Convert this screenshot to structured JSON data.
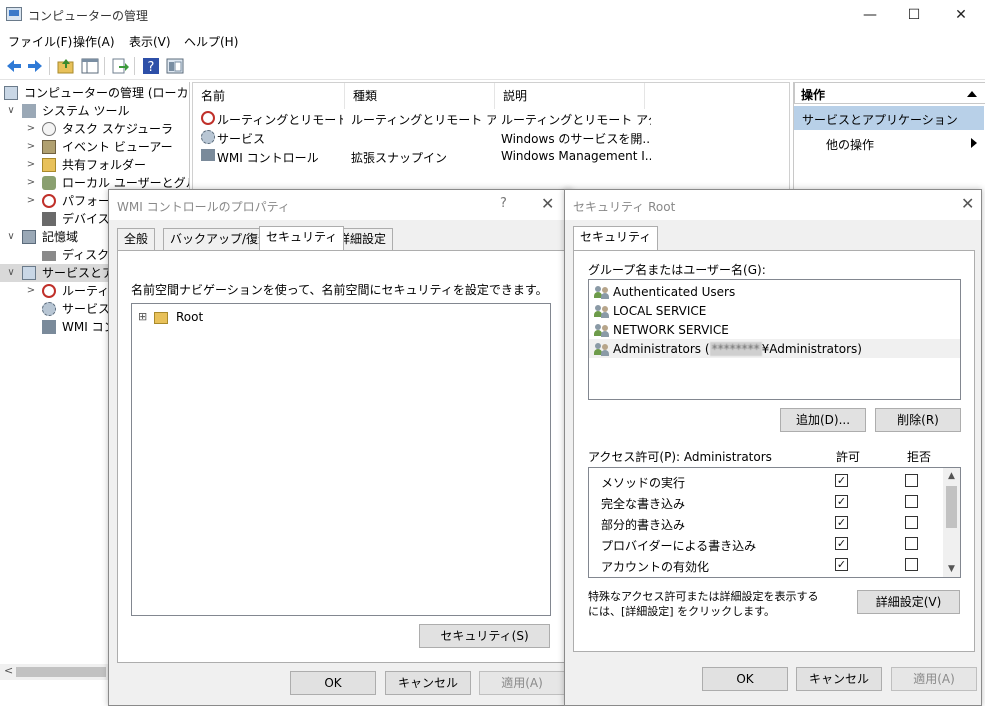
{
  "window": {
    "title": "コンピューターの管理",
    "minimize": "—",
    "maximize": "☐",
    "close": "✕"
  },
  "menu": [
    "ファイル(F)",
    "操作(A)",
    "表示(V)",
    "ヘルプ(H)"
  ],
  "toolbar": {
    "icons": [
      "back-icon",
      "forward-icon",
      "up-folder-icon",
      "show-hide-tree-icon",
      "export-icon",
      "help-icon",
      "console-icon"
    ]
  },
  "tree": {
    "items": [
      {
        "label": "コンピューターの管理 (ローカル)",
        "icon": "computer-management-icon"
      },
      {
        "label": "システム ツール",
        "icon": "tools-icon"
      },
      {
        "label": "タスク スケジューラ",
        "icon": "clock-icon"
      },
      {
        "label": "イベント ビューアー",
        "icon": "event-viewer-icon"
      },
      {
        "label": "共有フォルダー",
        "icon": "shared-folder-icon"
      },
      {
        "label": "ローカル ユーザーとグループ",
        "icon": "users-icon"
      },
      {
        "label": "パフォーマ",
        "icon": "performance-icon"
      },
      {
        "label": "デバイス マ",
        "icon": "device-manager-icon"
      },
      {
        "label": "記憶域",
        "icon": "storage-icon"
      },
      {
        "label": "ディスクの",
        "icon": "disk-icon"
      },
      {
        "label": "サービスとアプ",
        "icon": "services-apps-icon"
      },
      {
        "label": "ルーティン",
        "icon": "routing-icon"
      },
      {
        "label": "サービス",
        "icon": "gear-icon"
      },
      {
        "label": "WMI コン",
        "icon": "wmi-icon"
      }
    ]
  },
  "list": {
    "headers": [
      "名前",
      "種類",
      "説明"
    ],
    "rows": [
      {
        "name": "ルーティングとリモート アク...",
        "type": "ルーティングとリモート アクセス",
        "desc": "ルーティングとリモート アクセス",
        "icon": "routing-icon"
      },
      {
        "name": "サービス",
        "type": "",
        "desc": "Windows のサービスを開...",
        "icon": "gear-icon"
      },
      {
        "name": "WMI コントロール",
        "type": "拡張スナップイン",
        "desc": "Windows Management I...",
        "icon": "wmi-icon"
      }
    ]
  },
  "actions": {
    "title": "操作",
    "section": "サービスとアプリケーション",
    "item": "他の操作"
  },
  "wmi_dialog": {
    "title": "WMI コントロールのプロパティ",
    "help": "?",
    "close": "✕",
    "tabs": [
      "全般",
      "バックアップ/復元",
      "セキュリティ",
      "詳細設定"
    ],
    "description": "名前空間ナビゲーションを使って、名前空間にセキュリティを設定できます。",
    "tree_expand": "⊞",
    "tree_root": "Root",
    "security_button": "セキュリティ(S)",
    "ok": "OK",
    "cancel": "キャンセル",
    "apply": "適用(A)"
  },
  "security_dialog": {
    "title": "セキュリティ Root",
    "close": "✕",
    "tab": "セキュリティ",
    "group_label": "グループ名またはユーザー名(G):",
    "users": [
      {
        "name": "Authenticated Users"
      },
      {
        "name": "LOCAL SERVICE"
      },
      {
        "name": "NETWORK SERVICE"
      },
      {
        "name_prefix": "Administrators (",
        "masked": "********",
        "name_suffix": "¥Administrators)"
      }
    ],
    "add_button": "追加(D)...",
    "remove_button": "削除(R)",
    "perm_label": "アクセス許可(P): Administrators",
    "allow_header": "許可",
    "deny_header": "拒否",
    "permissions": [
      {
        "name": "メソッドの実行",
        "allow": true,
        "deny": false
      },
      {
        "name": "完全な書き込み",
        "allow": true,
        "deny": false
      },
      {
        "name": "部分的書き込み",
        "allow": true,
        "deny": false
      },
      {
        "name": "プロバイダーによる書き込み",
        "allow": true,
        "deny": false
      },
      {
        "name": "アカウントの有効化",
        "allow": true,
        "deny": false
      }
    ],
    "advanced_text_1": "特殊なアクセス許可または詳細設定を表示する",
    "advanced_text_2": "には、[詳細設定] をクリックします。",
    "advanced_button": "詳細設定(V)",
    "ok": "OK",
    "cancel": "キャンセル",
    "apply": "適用(A)"
  }
}
